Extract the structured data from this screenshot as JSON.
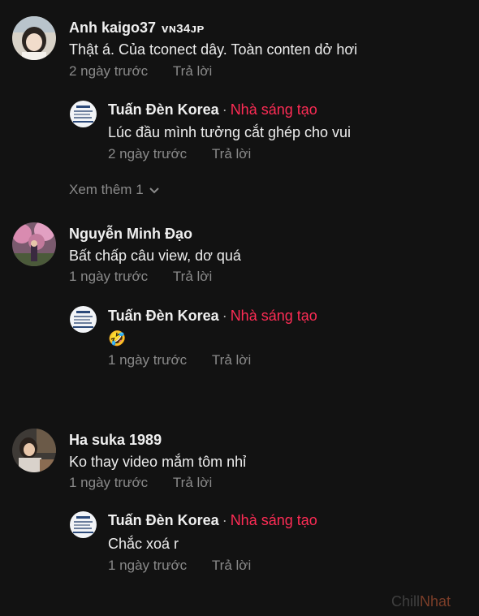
{
  "comments": [
    {
      "author": "Anh kaigo37",
      "badge": "ᴠɴ34ᴊᴘ",
      "text": "Thật á. Của tconect dây. Toàn conten dở hơi",
      "time": "2 ngày trước",
      "reply_label": "Trả lời",
      "reply": {
        "author": "Tuấn Đèn Korea",
        "separator": "·",
        "creator_label": "Nhà sáng tạo",
        "text": "Lúc đầu mình tưởng cắt ghép cho vui",
        "time": "2 ngày trước",
        "reply_label": "Trả lời"
      },
      "view_more": "Xem thêm 1"
    },
    {
      "author": "Nguyễn Minh Đạo",
      "text": "Bất chấp câu view, dơ quá",
      "time": "1 ngày trước",
      "reply_label": "Trả lời",
      "reply": {
        "author": "Tuấn Đèn Korea",
        "separator": "·",
        "creator_label": "Nhà sáng tạo",
        "text": "🤣",
        "time": "1 ngày trước",
        "reply_label": "Trả lời"
      }
    },
    {
      "author": "Ha suka 1989",
      "text": "Ko thay video mắm tôm nhỉ",
      "time": "1 ngày trước",
      "reply_label": "Trả lời",
      "reply": {
        "author": "Tuấn Đèn Korea",
        "separator": "·",
        "creator_label": "Nhà sáng tạo",
        "text": "Chắc xoá r",
        "time": "1 ngày trước",
        "reply_label": "Trả lời"
      }
    }
  ],
  "watermark": {
    "part1": "Chill",
    "part2": "Nhat"
  },
  "colors": {
    "background": "#121212",
    "creator": "#fe2c55",
    "meta": "#8a8a8a"
  }
}
